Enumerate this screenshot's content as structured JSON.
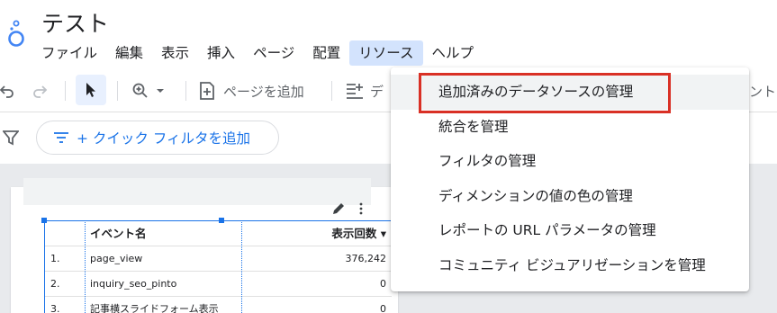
{
  "app": {
    "title": "テスト",
    "logo_icon": "looker-studio-logo",
    "brand_color": "#4285f4"
  },
  "menubar": {
    "items": [
      {
        "label": "ファイル",
        "active": false
      },
      {
        "label": "編集",
        "active": false
      },
      {
        "label": "表示",
        "active": false
      },
      {
        "label": "挿入",
        "active": false
      },
      {
        "label": "ページ",
        "active": false
      },
      {
        "label": "配置",
        "active": false
      },
      {
        "label": "リソース",
        "active": true
      },
      {
        "label": "ヘルプ",
        "active": false
      }
    ]
  },
  "toolbar": {
    "add_page_label": "ページを追加",
    "add_data_label_partial": "デ",
    "right_label_partial": "ントロ",
    "icons": [
      "undo-icon",
      "redo-icon",
      "select-cursor-icon",
      "zoom-icon",
      "add-page-icon",
      "add-data-icon"
    ]
  },
  "filterbar": {
    "quick_filter_label": "+ クイック フィルタを追加"
  },
  "table": {
    "columns": [
      "イベント名",
      "表示回数 ▾"
    ],
    "rows": [
      {
        "index": "1.",
        "name": "page_view",
        "value": "376,242"
      },
      {
        "index": "2.",
        "name": "inquiry_seo_pinto",
        "value": "0"
      },
      {
        "index": "3.",
        "name": "記事横スライドフォーム表示",
        "value": "0"
      }
    ]
  },
  "resource_menu": {
    "items": [
      {
        "label": "追加済みのデータソースの管理",
        "highlighted": true
      },
      {
        "label": "統合を管理",
        "highlighted": false
      },
      {
        "label": "フィルタの管理",
        "highlighted": false
      },
      {
        "label": "ディメンションの値の色の管理",
        "highlighted": false
      },
      {
        "label": "レポートの URL パラメータの管理",
        "highlighted": false
      },
      {
        "label": "コミュニティ ビジュアリゼーションを管理",
        "highlighted": false
      }
    ],
    "highlight_color": "#d93025"
  }
}
